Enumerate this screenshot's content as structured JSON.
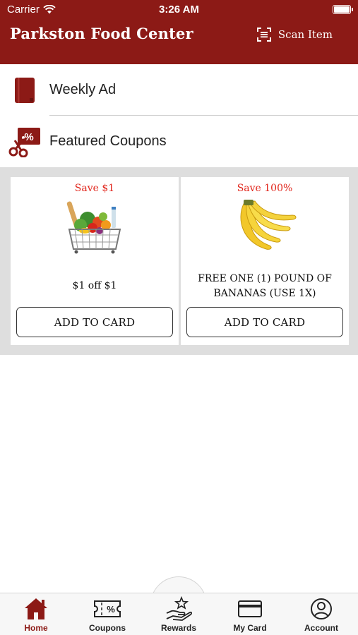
{
  "status_bar": {
    "carrier": "Carrier",
    "time": "3:26 AM"
  },
  "header": {
    "title": "Parkston Food Center",
    "scan_label": "Scan Item"
  },
  "menu": {
    "items": [
      {
        "label": "Weekly Ad",
        "icon": "book-icon"
      },
      {
        "label": "Featured Coupons",
        "icon": "coupon-scissors-icon"
      }
    ]
  },
  "coupons": [
    {
      "save": "Save $1",
      "description": "$1 off $1",
      "button": "ADD TO CARD",
      "image": "grocery-basket-image"
    },
    {
      "save": "Save 100%",
      "description": "FREE ONE (1) POUND OF BANANAS (USE 1X)",
      "button": "ADD TO CARD",
      "image": "bananas-image"
    }
  ],
  "tabs": [
    {
      "label": "Home",
      "icon": "home-icon",
      "active": true
    },
    {
      "label": "Coupons",
      "icon": "ticket-icon",
      "active": false
    },
    {
      "label": "Rewards",
      "icon": "hand-star-icon",
      "active": false
    },
    {
      "label": "My Card",
      "icon": "card-icon",
      "active": false
    },
    {
      "label": "Account",
      "icon": "user-circle-icon",
      "active": false
    }
  ],
  "colors": {
    "brand": "#8c1a16",
    "save_text": "#e1251b",
    "coupon_bg": "#dedede"
  }
}
